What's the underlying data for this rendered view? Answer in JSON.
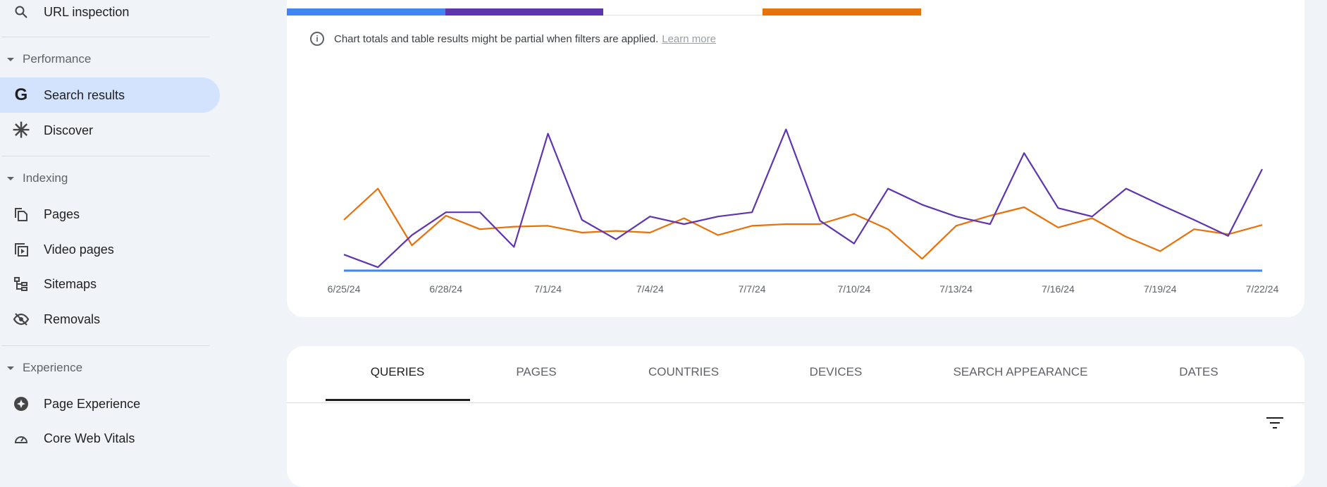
{
  "sidebar": {
    "url_inspection": {
      "label": "URL inspection",
      "icon": "search-icon"
    },
    "sections": [
      {
        "title": "Performance",
        "items": [
          {
            "label": "Search results",
            "icon": "google-g-icon",
            "active": true
          },
          {
            "label": "Discover",
            "icon": "asterisk-icon"
          }
        ]
      },
      {
        "title": "Indexing",
        "items": [
          {
            "label": "Pages",
            "icon": "pages-icon"
          },
          {
            "label": "Video pages",
            "icon": "video-pages-icon"
          },
          {
            "label": "Sitemaps",
            "icon": "sitemap-icon"
          },
          {
            "label": "Removals",
            "icon": "eye-off-icon"
          }
        ]
      },
      {
        "title": "Experience",
        "items": [
          {
            "label": "Page Experience",
            "icon": "page-experience-icon"
          },
          {
            "label": "Core Web Vitals",
            "icon": "speedometer-icon"
          }
        ]
      }
    ]
  },
  "chart_card": {
    "metric_colors": [
      "#4285f4",
      "#5e35b1",
      "#ffffff",
      "#e8710a"
    ],
    "info_text": "Chart totals and table results might be partial when filters are applied.",
    "learn_more": "Learn more"
  },
  "chart_data": {
    "type": "line",
    "x": [
      "6/25/24",
      "6/26/24",
      "6/27/24",
      "6/28/24",
      "6/29/24",
      "6/30/24",
      "7/1/24",
      "7/2/24",
      "7/3/24",
      "7/4/24",
      "7/5/24",
      "7/6/24",
      "7/7/24",
      "7/8/24",
      "7/9/24",
      "7/10/24",
      "7/11/24",
      "7/12/24",
      "7/13/24",
      "7/14/24",
      "7/15/24",
      "7/16/24",
      "7/17/24",
      "7/18/24",
      "7/19/24",
      "7/20/24",
      "7/21/24",
      "7/22/24"
    ],
    "tick_labels": [
      "6/25/24",
      "6/28/24",
      "7/1/24",
      "7/4/24",
      "7/7/24",
      "7/10/24",
      "7/13/24",
      "7/16/24",
      "7/19/24",
      "7/22/24"
    ],
    "series": [
      {
        "color": "#4285f4",
        "values": [
          0,
          0,
          0,
          0,
          0,
          0,
          0,
          0,
          0,
          0,
          0,
          0,
          0,
          0,
          0,
          0,
          0,
          0,
          0,
          0,
          0,
          0,
          0,
          0,
          0,
          0,
          0,
          0
        ]
      },
      {
        "color": "#5e35b1",
        "values": [
          19,
          4,
          42,
          69,
          69,
          28,
          162,
          60,
          37,
          64,
          55,
          64,
          69,
          167,
          59,
          32,
          97,
          78,
          64,
          55,
          139,
          74,
          64,
          97,
          78,
          60,
          41,
          120
        ]
      },
      {
        "color": "#e8710a",
        "values": [
          60,
          97,
          30,
          65,
          49,
          52,
          53,
          45,
          47,
          45,
          62,
          42,
          53,
          55,
          55,
          67,
          49,
          14,
          53,
          65,
          75,
          51,
          62,
          40,
          23,
          49,
          43,
          54
        ]
      }
    ],
    "grid": false,
    "y_axis_visible": false
  },
  "table_card": {
    "tabs": [
      "QUERIES",
      "PAGES",
      "COUNTRIES",
      "DEVICES",
      "SEARCH APPEARANCE",
      "DATES"
    ],
    "active_tab": "QUERIES",
    "filter_icon": "filter-icon"
  }
}
